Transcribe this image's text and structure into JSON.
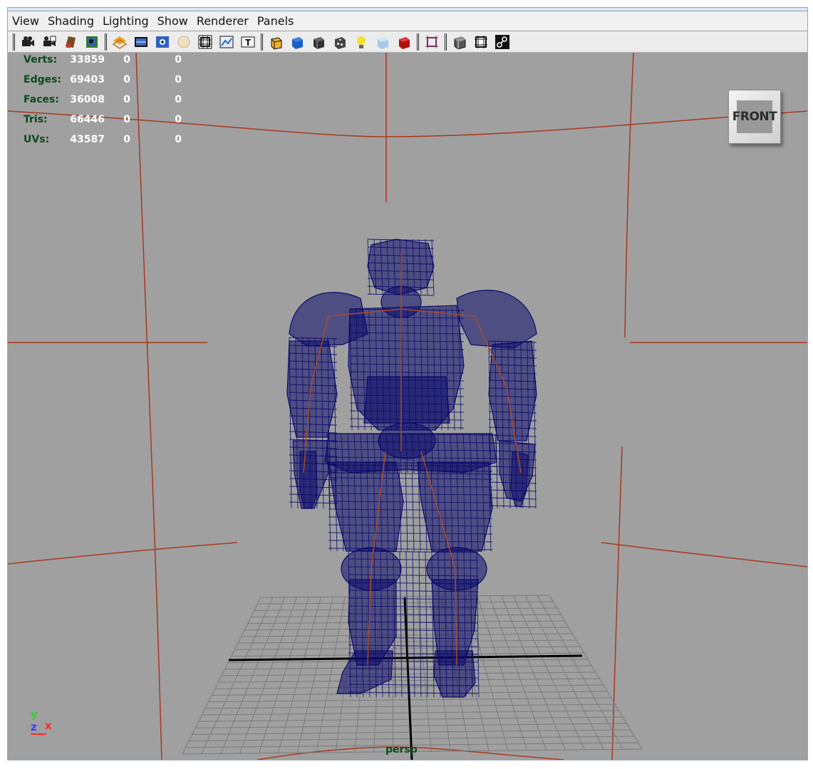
{
  "menu": {
    "items": [
      "View",
      "Shading",
      "Lighting",
      "Show",
      "Renderer",
      "Panels"
    ]
  },
  "toolbar": {
    "icons": [
      "select-camera",
      "lock-camera",
      "camera-attributes",
      "image-plane",
      "two-d-pan-zoom",
      "grease-pencil",
      "grid",
      "film-gate",
      "resolution-gate",
      "gate-mask",
      "field-chart",
      "safe-action",
      "safe-title",
      "wireframe",
      "smooth-shade",
      "wireframe-on-shaded",
      "textured",
      "use-all-lights",
      "shadows",
      "ambient-occlusion",
      "isolate-select",
      "xray",
      "xray-joints",
      "xray-components"
    ]
  },
  "hud": {
    "rows": [
      {
        "label": "Verts:",
        "values": [
          "33859",
          "0",
          "0"
        ]
      },
      {
        "label": "Edges:",
        "values": [
          "69403",
          "0",
          "0"
        ]
      },
      {
        "label": "Faces:",
        "values": [
          "36008",
          "0",
          "0"
        ]
      },
      {
        "label": "Tris:",
        "values": [
          "66446",
          "0",
          "0"
        ]
      },
      {
        "label": "UVs:",
        "values": [
          "43587",
          "0",
          "0"
        ]
      }
    ]
  },
  "view_cube": {
    "face_label": "FRONT"
  },
  "axis": {
    "y": "y",
    "z": "z",
    "x": "x"
  },
  "camera": {
    "name": "persp"
  },
  "colors": {
    "viewport_bg": "#a0a0a0",
    "wireframe": "#0b0b6b",
    "guide_lines": "#a8381e",
    "grid": "#7a7a7a",
    "hud_label": "#0c4a1a",
    "hud_value": "#ffffff"
  }
}
